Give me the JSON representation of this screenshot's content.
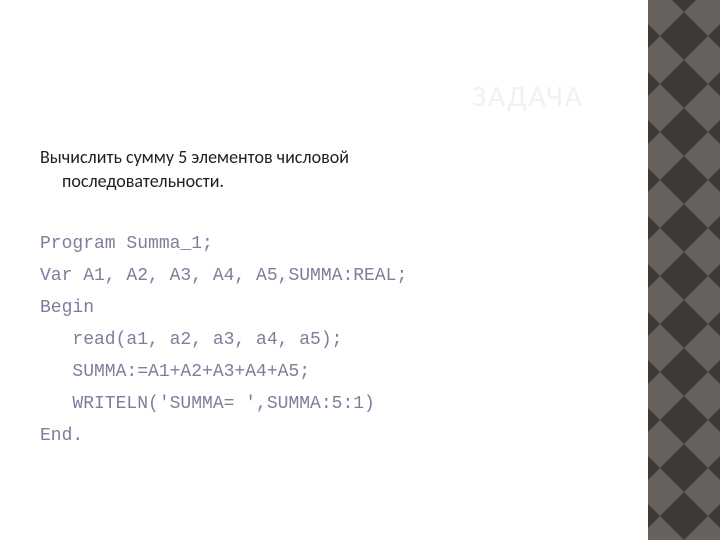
{
  "title": "ЗАДАЧА",
  "task": {
    "line1": "Вычислить сумму 5 элементов числовой",
    "line2": "последовательности."
  },
  "code": {
    "l1": "Program Summa_1;",
    "l2": "Var A1, A2, A3, A4, A5,SUMMA:REAL;",
    "l3": "Begin",
    "l4": "   read(a1, a2, a3, a4, a5);",
    "l5": "   SUMMA:=A1+A2+A3+A4+A5;",
    "l6": "   WRITELN('SUMMA= ',SUMMA:5:1)",
    "l7": "End."
  },
  "colors": {
    "diamond_dark": "#3d3a38",
    "diamond_light": "#67625e"
  }
}
